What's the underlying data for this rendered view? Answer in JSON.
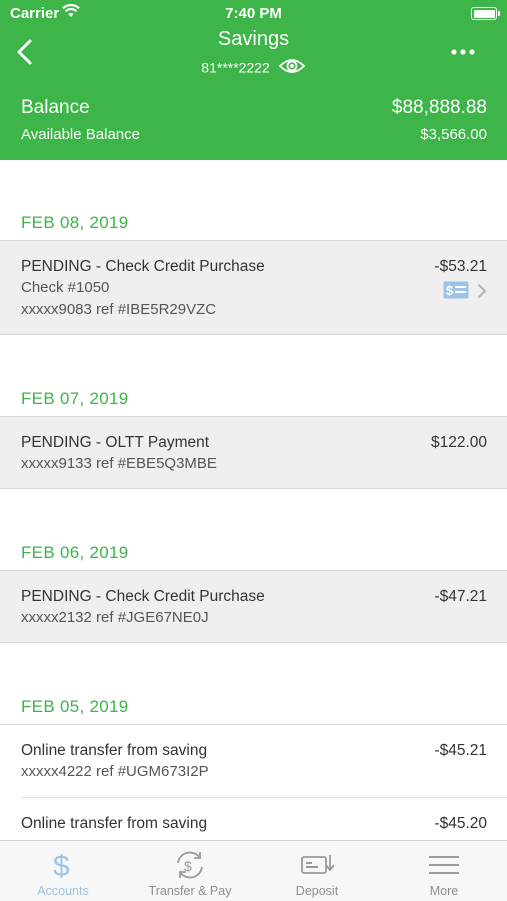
{
  "status_bar": {
    "carrier": "Carrier",
    "time": "7:40 PM"
  },
  "header": {
    "title": "Savings",
    "account_masked": "81****2222",
    "balance_label": "Balance",
    "balance_value": "$88,888.88",
    "available_label": "Available Balance",
    "available_value": "$3,566.00",
    "color": "#3db548"
  },
  "groups": [
    {
      "date": "FEB 08, 2019",
      "transactions": [
        {
          "description": "PENDING - Check Credit Purchase",
          "line2": "Check #1050",
          "line3": "xxxxx9083 ref #IBE5R29VZC",
          "amount": "-$53.21"
        }
      ]
    },
    {
      "date": "FEB 07, 2019",
      "transactions": [
        {
          "description": "PENDING - OLTT Payment",
          "line2": "xxxxx9133 ref #EBE5Q3MBE",
          "amount": "$122.00"
        }
      ]
    },
    {
      "date": "FEB 06, 2019",
      "transactions": [
        {
          "description": "PENDING - Check Credit Purchase",
          "line2": "xxxxx2132 ref #JGE67NE0J",
          "amount": "-$47.21"
        }
      ]
    },
    {
      "date": "FEB 05, 2019",
      "transactions": [
        {
          "description": "Online transfer from saving",
          "line2": "xxxxx4222 ref #UGM673I2P",
          "amount": "-$45.21"
        },
        {
          "description": "Online transfer from saving",
          "line2": "",
          "amount": "-$45.20"
        }
      ]
    }
  ],
  "tabs": [
    {
      "label": "Accounts",
      "icon": "dollar-icon",
      "active": true
    },
    {
      "label": "Transfer & Pay",
      "icon": "transfer-icon",
      "active": false
    },
    {
      "label": "Deposit",
      "icon": "deposit-check-icon",
      "active": false
    },
    {
      "label": "More",
      "icon": "menu-icon",
      "active": false
    }
  ],
  "colors": {
    "accent": "#3db548",
    "active_tab": "#9dc3e6",
    "row_grey": "#efefef"
  }
}
